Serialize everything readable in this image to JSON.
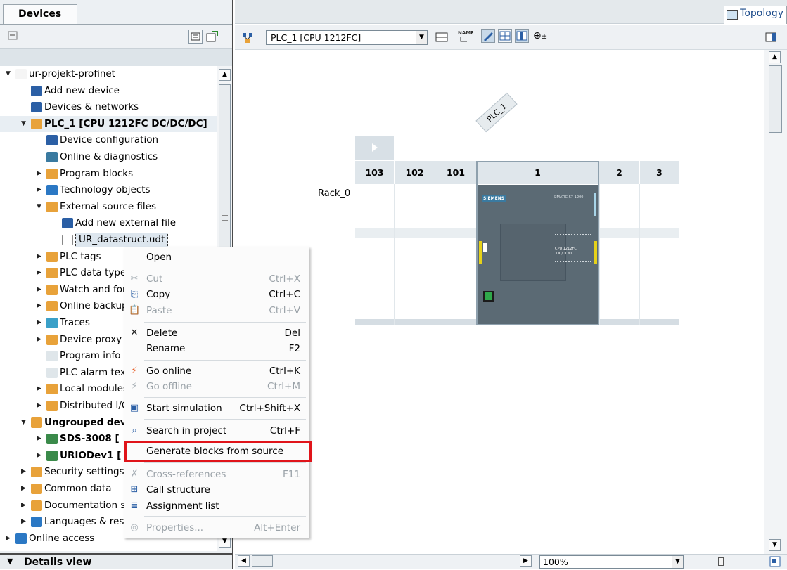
{
  "project_panel": {
    "tab_label": "Devices",
    "details_label": "Details view",
    "tree": [
      {
        "label": "ur-projekt-profinet",
        "arrow": "open"
      },
      {
        "label": "Add new device",
        "arrow": ""
      },
      {
        "label": "Devices & networks",
        "arrow": ""
      },
      {
        "label": "PLC_1 [CPU 1212FC DC/DC/DC]",
        "arrow": "open",
        "bold": true
      },
      {
        "label": "Device configuration",
        "arrow": ""
      },
      {
        "label": "Online & diagnostics",
        "arrow": ""
      },
      {
        "label": "Program blocks",
        "arrow": "closed"
      },
      {
        "label": "Technology objects",
        "arrow": "closed"
      },
      {
        "label": "External source files",
        "arrow": "open"
      },
      {
        "label": "Add new external file",
        "arrow": ""
      },
      {
        "label": "UR_datastruct.udt",
        "arrow": "",
        "selected": true
      },
      {
        "label": "PLC tags",
        "arrow": "closed"
      },
      {
        "label": "PLC data types",
        "arrow": "closed"
      },
      {
        "label": "Watch and force tables",
        "arrow": "closed"
      },
      {
        "label": "Online backups",
        "arrow": "closed"
      },
      {
        "label": "Traces",
        "arrow": "closed"
      },
      {
        "label": "Device proxy data",
        "arrow": "closed"
      },
      {
        "label": "Program info",
        "arrow": ""
      },
      {
        "label": "PLC alarm text lists",
        "arrow": ""
      },
      {
        "label": "Local modules",
        "arrow": "closed"
      },
      {
        "label": "Distributed I/O",
        "arrow": "closed"
      },
      {
        "label": "Ungrouped devices",
        "arrow": "open",
        "bold": true
      },
      {
        "label": "SDS-3008 [",
        "arrow": "closed",
        "bold": true
      },
      {
        "label": "URIODev1 [",
        "arrow": "closed",
        "bold": true
      },
      {
        "label": "Security settings",
        "arrow": "closed"
      },
      {
        "label": "Common data",
        "arrow": "closed"
      },
      {
        "label": "Documentation settings",
        "arrow": "closed"
      },
      {
        "label": "Languages & resources",
        "arrow": "closed"
      },
      {
        "label": "Online access",
        "arrow": "closed"
      }
    ]
  },
  "device_view": {
    "topology_tab": "Topology",
    "plc_select": "PLC_1 [CPU 1212FC]",
    "zoom": "100%",
    "plc_label": "PLC_1",
    "rack_label": "Rack_0",
    "slots": [
      "103",
      "102",
      "101",
      "1",
      "2",
      "3"
    ],
    "cpu_brand": "SIEMENS",
    "cpu_series": "SIMATIC S7-1200",
    "cpu_model": "CPU 1212FC",
    "cpu_type": "DC/DC/DC"
  },
  "context_menu": {
    "items": [
      {
        "label": "Open",
        "shortcut": "",
        "icon": "",
        "disabled": false
      },
      {
        "label": "Cut",
        "shortcut": "Ctrl+X",
        "icon": "scissors-icon",
        "disabled": true
      },
      {
        "label": "Copy",
        "shortcut": "Ctrl+C",
        "icon": "copy-icon",
        "disabled": false
      },
      {
        "label": "Paste",
        "shortcut": "Ctrl+V",
        "icon": "paste-icon",
        "disabled": true
      },
      {
        "label": "Delete",
        "shortcut": "Del",
        "icon": "delete-icon",
        "disabled": false
      },
      {
        "label": "Rename",
        "shortcut": "F2",
        "icon": "",
        "disabled": false
      },
      {
        "label": "Go online",
        "shortcut": "Ctrl+K",
        "icon": "go-online-icon",
        "disabled": false
      },
      {
        "label": "Go offline",
        "shortcut": "Ctrl+M",
        "icon": "go-offline-icon",
        "disabled": true
      },
      {
        "label": "Start simulation",
        "shortcut": "Ctrl+Shift+X",
        "icon": "simulation-icon",
        "disabled": false
      },
      {
        "label": "Search in project",
        "shortcut": "Ctrl+F",
        "icon": "binoculars-icon",
        "disabled": false
      },
      {
        "label": "Generate blocks from source",
        "shortcut": "",
        "icon": "",
        "disabled": false
      },
      {
        "label": "Cross-references",
        "shortcut": "F11",
        "icon": "cross-references-icon",
        "disabled": true
      },
      {
        "label": "Call structure",
        "shortcut": "",
        "icon": "call-structure-icon",
        "disabled": false
      },
      {
        "label": "Assignment list",
        "shortcut": "",
        "icon": "assignment-list-icon",
        "disabled": false
      },
      {
        "label": "Properties...",
        "shortcut": "Alt+Enter",
        "icon": "properties-icon",
        "disabled": true
      }
    ]
  },
  "colors": {
    "highlight": "#e0141a",
    "cpu_body": "#5b6a74",
    "slot_header": "#dfe6eb"
  }
}
